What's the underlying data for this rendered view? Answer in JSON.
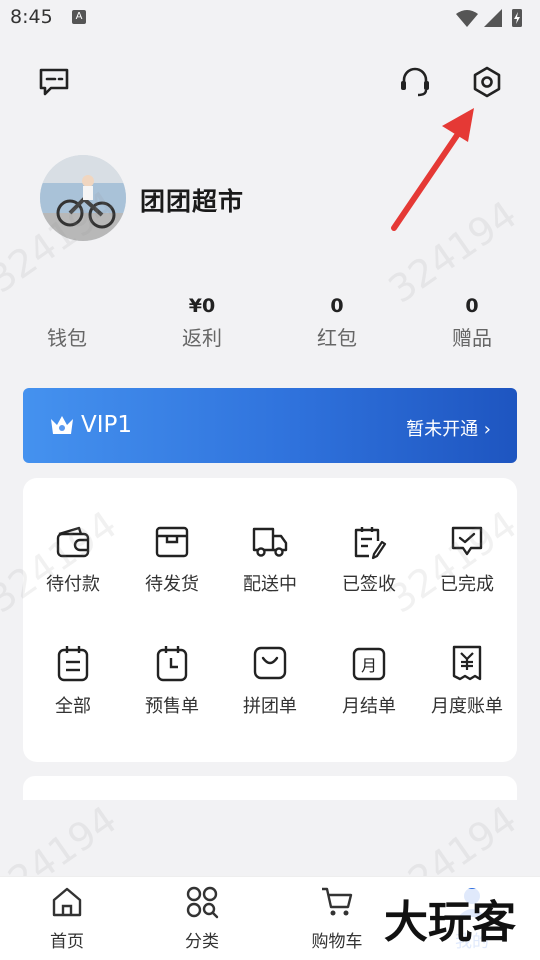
{
  "status_bar": {
    "time": "8:45",
    "notification_badge": "A"
  },
  "header": {
    "message_icon": "message-icon",
    "customer_service_icon": "headset-icon",
    "settings_icon": "settings-icon"
  },
  "profile": {
    "store_name": "团团超市"
  },
  "stats": [
    {
      "value": "",
      "label": "钱包"
    },
    {
      "value": "¥0",
      "label": "返利"
    },
    {
      "value": "0",
      "label": "红包"
    },
    {
      "value": "0",
      "label": "赠品"
    }
  ],
  "vip": {
    "level": "VIP1",
    "action": "暂未开通 ›"
  },
  "orders": {
    "row1": [
      {
        "label": "待付款",
        "icon": "wallet-icon"
      },
      {
        "label": "待发货",
        "icon": "box-icon"
      },
      {
        "label": "配送中",
        "icon": "truck-icon"
      },
      {
        "label": "已签收",
        "icon": "signed-icon"
      },
      {
        "label": "已完成",
        "icon": "completed-icon"
      }
    ],
    "row2": [
      {
        "label": "全部",
        "icon": "list-icon"
      },
      {
        "label": "预售单",
        "icon": "clock-calendar-icon"
      },
      {
        "label": "拼团单",
        "icon": "group-bag-icon"
      },
      {
        "label": "月结单",
        "icon": "month-icon"
      },
      {
        "label": "月度账单",
        "icon": "bill-icon"
      }
    ]
  },
  "watermark": "324194",
  "tabbar": {
    "items": [
      {
        "label": "首页",
        "icon": "home-icon"
      },
      {
        "label": "分类",
        "icon": "category-icon"
      },
      {
        "label": "购物车",
        "icon": "cart-icon"
      },
      {
        "label": "我的",
        "icon": "profile-icon"
      }
    ],
    "active_color": "#2f6fe0"
  },
  "overlay_logo": "大玩客",
  "colors": {
    "vip_start": "#4592ef",
    "vip_end": "#1e55c0",
    "annotation": "#e53935"
  }
}
